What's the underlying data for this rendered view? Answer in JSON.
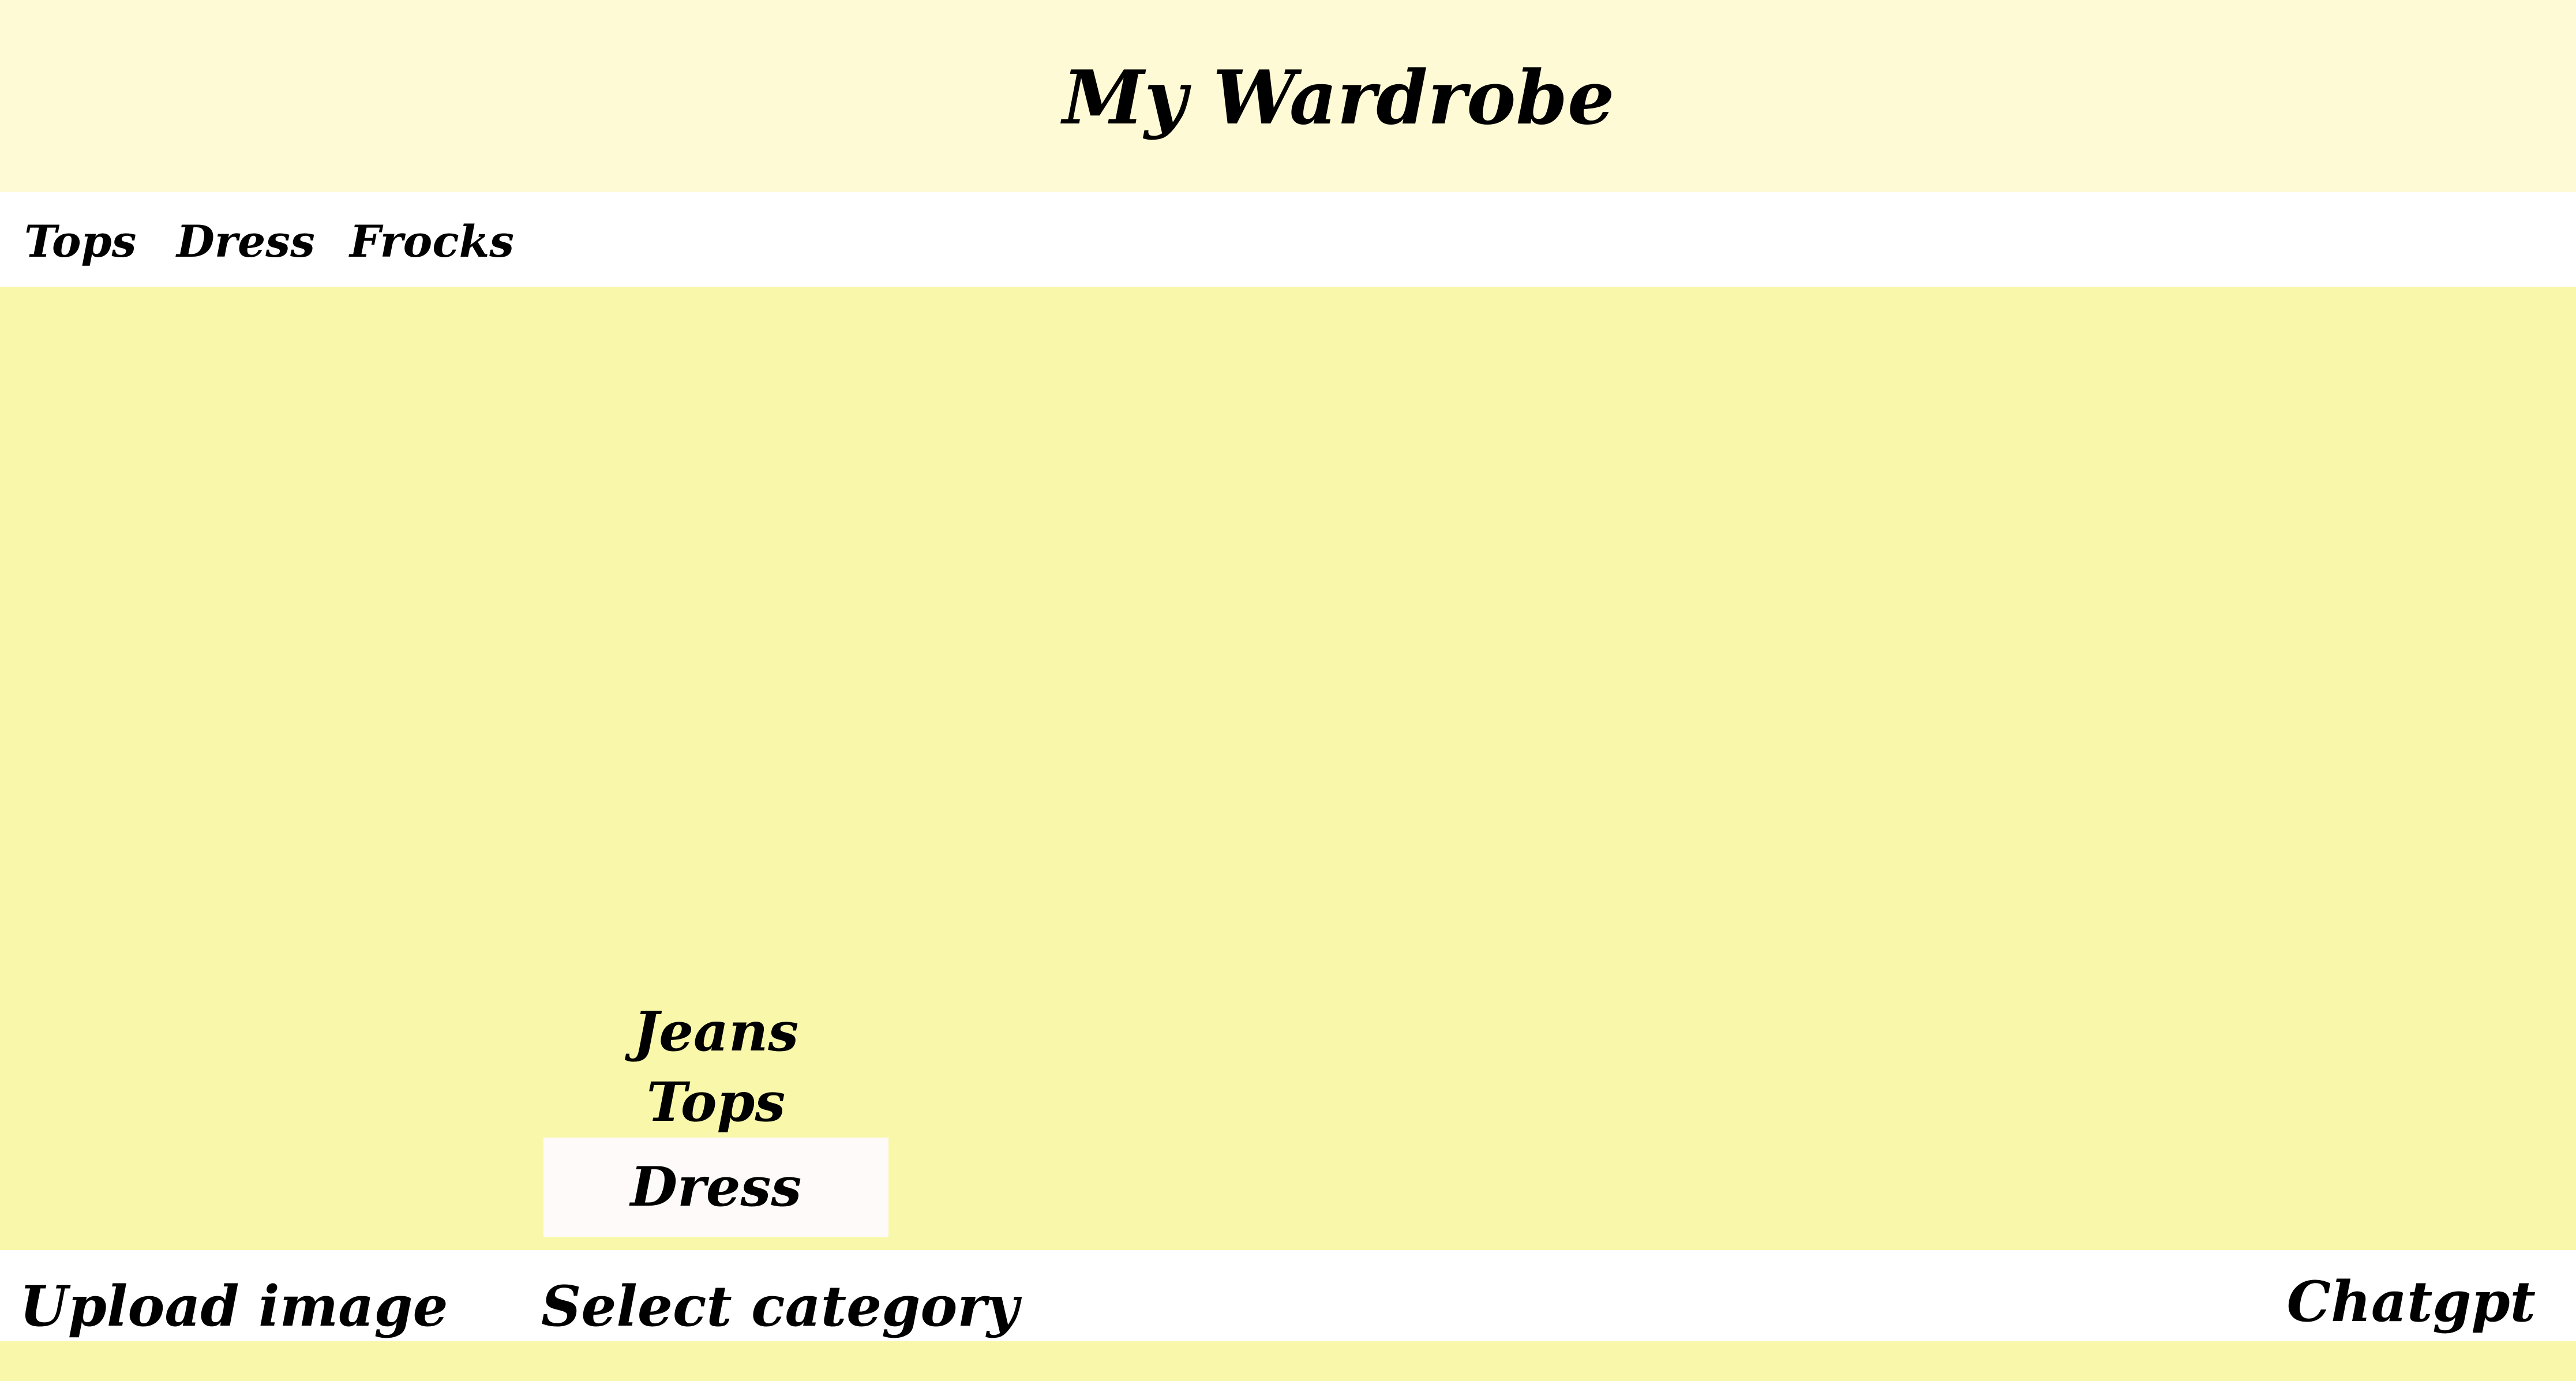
{
  "app": {
    "title": "My Wardrobe"
  },
  "nav": {
    "items": [
      {
        "label": "Tops"
      },
      {
        "label": "Dress"
      },
      {
        "label": "Frocks"
      }
    ]
  },
  "category_dropdown": {
    "options": [
      {
        "label": "Jeans"
      },
      {
        "label": "Tops"
      },
      {
        "label": "Dress"
      }
    ],
    "highlighted": "Dress"
  },
  "footer": {
    "upload_label": "Upload image",
    "select_category_label": "Select category",
    "chatgpt_label": "Chatgpt"
  },
  "colors": {
    "header_bg": "#fefad6",
    "main_bg": "#f9f7aa",
    "nav_bg": "#ffffff",
    "highlight_bg": "#fffafa"
  }
}
